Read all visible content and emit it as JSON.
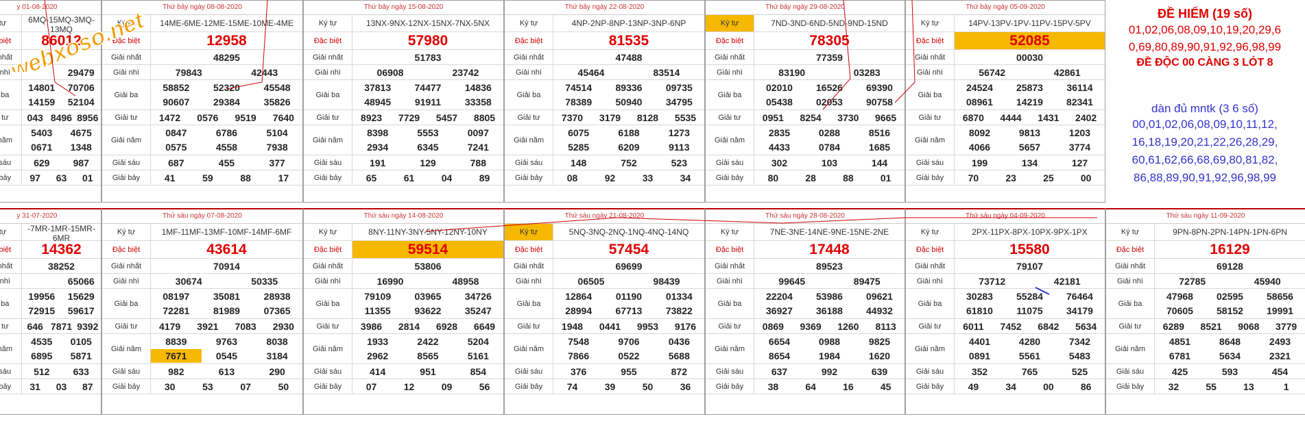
{
  "logo_text": "webxoso.net",
  "side_panel": {
    "title": "ĐỀ HIỂM (19 số)",
    "numbers_lines": [
      "01,02,06,08,09,10,19,20,29,6",
      "0,69,80,89,90,91,92,96,98,99"
    ],
    "special_note": "ĐỀ ĐỘC 00 CÀNG 3 LÓT 8",
    "set_title": "dàn đủ mntk (3 6 số)",
    "set_lines": [
      "00,01,02,06,08,09,10,11,12,",
      "16,18,19,20,21,22,26,28,29,",
      "60,61,62,66,68,69,80,81,82,",
      "86,88,89,90,91,92,96,98,99"
    ]
  },
  "labels": {
    "ky_tu": "Ký tự",
    "dac_biet": "Đặc biệt",
    "nhat": "Giải nhất",
    "nhi": "Giải nhì",
    "ba": "Giải ba",
    "tu": "Giải tư",
    "nam": "Giải năm",
    "sau": "Giải sáu",
    "bay": "Giải bảy"
  },
  "top_row": [
    {
      "header": "y 01-08-2020",
      "codes": "6MQ-15MQ-3MQ-13MQ",
      "special": "86012",
      "nhat": "",
      "nhi": [
        "",
        "29479"
      ],
      "ba": [
        "14801",
        "70706",
        "14159",
        "52104"
      ],
      "tu": [
        "043",
        "8496",
        "8956"
      ],
      "nam": [
        "5403",
        "4675",
        "0671",
        "1348"
      ],
      "sau": [
        "629",
        "987"
      ],
      "bay": [
        "97",
        "63",
        "01"
      ]
    },
    {
      "header": "Thứ bảy ngày 08-08-2020",
      "codes": "14ME-6ME-12ME-15ME-10ME-4ME",
      "special": "12958",
      "nhat": "48295",
      "nhi": [
        "79843",
        "42443"
      ],
      "ba": [
        "58852",
        "52320",
        "45548",
        "90607",
        "29384",
        "35826"
      ],
      "tu": [
        "1472",
        "0576",
        "9519",
        "7640"
      ],
      "nam": [
        "0847",
        "6786",
        "5104",
        "0575",
        "4558",
        "7938"
      ],
      "sau": [
        "687",
        "455",
        "377"
      ],
      "bay": [
        "41",
        "59",
        "88",
        "17"
      ]
    },
    {
      "header": "Thứ bảy ngày 15-08-2020",
      "codes": "13NX-9NX-12NX-15NX-7NX-5NX",
      "special": "57980",
      "nhat": "51783",
      "nhi": [
        "06908",
        "23742"
      ],
      "ba": [
        "37813",
        "74477",
        "14836",
        "48945",
        "91911",
        "33358"
      ],
      "tu": [
        "8923",
        "7729",
        "5457",
        "8805"
      ],
      "nam": [
        "8398",
        "5553",
        "0097",
        "2934",
        "6345",
        "7241"
      ],
      "sau": [
        "191",
        "129",
        "788"
      ],
      "bay": [
        "65",
        "61",
        "04",
        "89"
      ]
    },
    {
      "header": "Thứ bảy ngày 22-08-2020",
      "codes": "4NP-2NP-8NP-13NP-3NP-6NP",
      "special": "81535",
      "nhat": "47488",
      "nhi": [
        "45464",
        "83514"
      ],
      "ba": [
        "74514",
        "89336",
        "09735",
        "78389",
        "50940",
        "34795"
      ],
      "tu": [
        "7370",
        "3179",
        "8128",
        "5535"
      ],
      "nam": [
        "6075",
        "6188",
        "1273",
        "5285",
        "6209",
        "9113"
      ],
      "sau": [
        "148",
        "752",
        "523"
      ],
      "bay": [
        "08",
        "92",
        "33",
        "34"
      ]
    },
    {
      "header": "Thứ bảy ngày 29-08-2020",
      "codes": "7ND-3ND-6ND-5ND-9ND-15ND",
      "special": "78305",
      "nhat": "77359",
      "nhi": [
        "83190",
        "03283"
      ],
      "ba": [
        "02010",
        "16526",
        "69390",
        "05438",
        "02053",
        "90758"
      ],
      "tu": [
        "0951",
        "8254",
        "3730",
        "9665"
      ],
      "nam": [
        "2835",
        "0288",
        "8516",
        "4433",
        "0784",
        "1685"
      ],
      "sau": [
        "302",
        "103",
        "144"
      ],
      "bay": [
        "80",
        "28",
        "88",
        "01"
      ]
    },
    {
      "header": "Thứ bảy ngày 05-09-2020",
      "codes": "14PV-13PV-1PV-11PV-15PV-5PV",
      "special": "52085",
      "nhat": "00030",
      "nhi": [
        "56742",
        "42861"
      ],
      "ba": [
        "24524",
        "25873",
        "36114",
        "08961",
        "14219",
        "82341"
      ],
      "tu": [
        "6870",
        "4444",
        "1431",
        "2402"
      ],
      "nam": [
        "8092",
        "9813",
        "1203",
        "4066",
        "5657",
        "3774"
      ],
      "sau": [
        "199",
        "134",
        "127"
      ],
      "bay": [
        "70",
        "23",
        "25",
        "00"
      ]
    }
  ],
  "bottom_row": [
    {
      "header": "y 31-07-2020",
      "codes": "-7MR-1MR-15MR-6MR",
      "special": "14362",
      "nhat": "38252",
      "nhi": [
        "",
        "65066"
      ],
      "ba": [
        "19956",
        "15629",
        "72915",
        "59617"
      ],
      "tu": [
        "646",
        "7871",
        "9392"
      ],
      "nam": [
        "4535",
        "0105",
        "6895",
        "5871"
      ],
      "sau": [
        "512",
        "633"
      ],
      "bay": [
        "31",
        "03",
        "87"
      ]
    },
    {
      "header": "Thứ sáu ngày 07-08-2020",
      "codes": "1MF-11MF-13MF-10MF-14MF-6MF",
      "special": "43614",
      "nhat": "70914",
      "nhi": [
        "30674",
        "50335"
      ],
      "ba": [
        "08197",
        "35081",
        "28938",
        "72281",
        "81989",
        "07365"
      ],
      "tu": [
        "4179",
        "3921",
        "7083",
        "2930"
      ],
      "nam": [
        "8839",
        "9763",
        "8038",
        "7671",
        "0545",
        "3184"
      ],
      "sau": [
        "982",
        "613",
        "290"
      ],
      "bay": [
        "30",
        "53",
        "07",
        "50"
      ]
    },
    {
      "header": "Thứ sáu ngày 14-08-2020",
      "codes": "8NY-11NY-3NY-5NY-12NY-10NY",
      "special": "59514",
      "nhat": "53806",
      "nhi": [
        "16990",
        "48958"
      ],
      "ba": [
        "79109",
        "03965",
        "34726",
        "11355",
        "93622",
        "35247"
      ],
      "tu": [
        "3986",
        "2814",
        "6928",
        "6649"
      ],
      "nam": [
        "1933",
        "2422",
        "5204",
        "2962",
        "8565",
        "5161"
      ],
      "sau": [
        "414",
        "951",
        "854"
      ],
      "bay": [
        "07",
        "12",
        "09",
        "56"
      ]
    },
    {
      "header": "Thứ sáu ngày 21-08-2020",
      "codes": "5NQ-3NQ-2NQ-1NQ-4NQ-14NQ",
      "special": "57454",
      "nhat": "69699",
      "nhi": [
        "06505",
        "98439"
      ],
      "ba": [
        "12864",
        "01190",
        "01334",
        "28994",
        "67713",
        "73822"
      ],
      "tu": [
        "1948",
        "0441",
        "9953",
        "9176"
      ],
      "nam": [
        "7548",
        "9706",
        "0436",
        "7866",
        "0522",
        "5688"
      ],
      "sau": [
        "376",
        "955",
        "872"
      ],
      "bay": [
        "74",
        "39",
        "50",
        "36"
      ]
    },
    {
      "header": "Thứ sáu ngày 28-08-2020",
      "codes": "7NE-3NE-14NE-9NE-15NE-2NE",
      "special": "17448",
      "nhat": "89523",
      "nhi": [
        "99645",
        "89475"
      ],
      "ba": [
        "22204",
        "53986",
        "09621",
        "36927",
        "36188",
        "44932"
      ],
      "tu": [
        "0869",
        "9369",
        "1260",
        "8113"
      ],
      "nam": [
        "6654",
        "0988",
        "9825",
        "8654",
        "1984",
        "1620"
      ],
      "sau": [
        "637",
        "992",
        "639"
      ],
      "bay": [
        "38",
        "64",
        "16",
        "45"
      ]
    },
    {
      "header": "Thứ sáu ngày 04-09-2020",
      "codes": "2PX-11PX-8PX-10PX-9PX-1PX",
      "special": "15580",
      "nhat": "79107",
      "nhi": [
        "73712",
        "42181"
      ],
      "ba": [
        "30283",
        "55284",
        "76464",
        "61810",
        "11075",
        "34179"
      ],
      "tu": [
        "6011",
        "7452",
        "6842",
        "5634"
      ],
      "nam": [
        "4401",
        "4280",
        "7342",
        "0891",
        "5561",
        "5483"
      ],
      "sau": [
        "352",
        "765",
        "525"
      ],
      "bay": [
        "49",
        "34",
        "00",
        "86"
      ]
    },
    {
      "header": "Thứ sáu ngày 11-09-2020",
      "codes": "9PN-8PN-2PN-14PN-1PN-6PN",
      "special": "16129",
      "nhat": "69128",
      "nhi": [
        "72785",
        "45940"
      ],
      "ba": [
        "47968",
        "02595",
        "58656",
        "70605",
        "58152",
        "19991"
      ],
      "tu": [
        "6289",
        "8521",
        "9068",
        "3779"
      ],
      "nam": [
        "4851",
        "8648",
        "2493",
        "6781",
        "5634",
        "2321"
      ],
      "sau": [
        "425",
        "593",
        "454"
      ],
      "bay": [
        "32",
        "55",
        "13",
        "1"
      ]
    }
  ],
  "colors": {
    "accent_red": "#e00000",
    "highlight": "#f6b800",
    "blue": "#3333cc"
  }
}
